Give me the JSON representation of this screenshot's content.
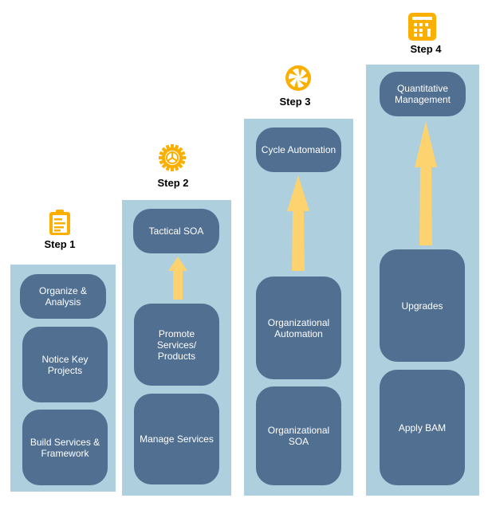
{
  "colors": {
    "column_bg": "#aecfde",
    "box_bg": "#506f91",
    "box_text": "#ffffff",
    "arrow": "#fdd36f",
    "icon": "#fbaf00"
  },
  "steps": [
    {
      "label": "Step 1",
      "icon": "clipboard-icon",
      "boxes": [
        "Organize &\nAnalysis",
        "Notice Key\nProjects",
        "Build Services &\nFramework"
      ]
    },
    {
      "label": "Step 2",
      "icon": "gear-icon",
      "boxes": [
        "Tactical SOA",
        "Promote Services/\nProducts",
        "Manage Services"
      ]
    },
    {
      "label": "Step 3",
      "icon": "aperture-icon",
      "boxes": [
        "Cycle Automation",
        "Organizational\nAutomation",
        "Organizational\nSOA"
      ]
    },
    {
      "label": "Step 4",
      "icon": "calculator-icon",
      "boxes": [
        "Quantitative\nManagement",
        "Upgrades",
        "Apply BAM"
      ]
    }
  ]
}
